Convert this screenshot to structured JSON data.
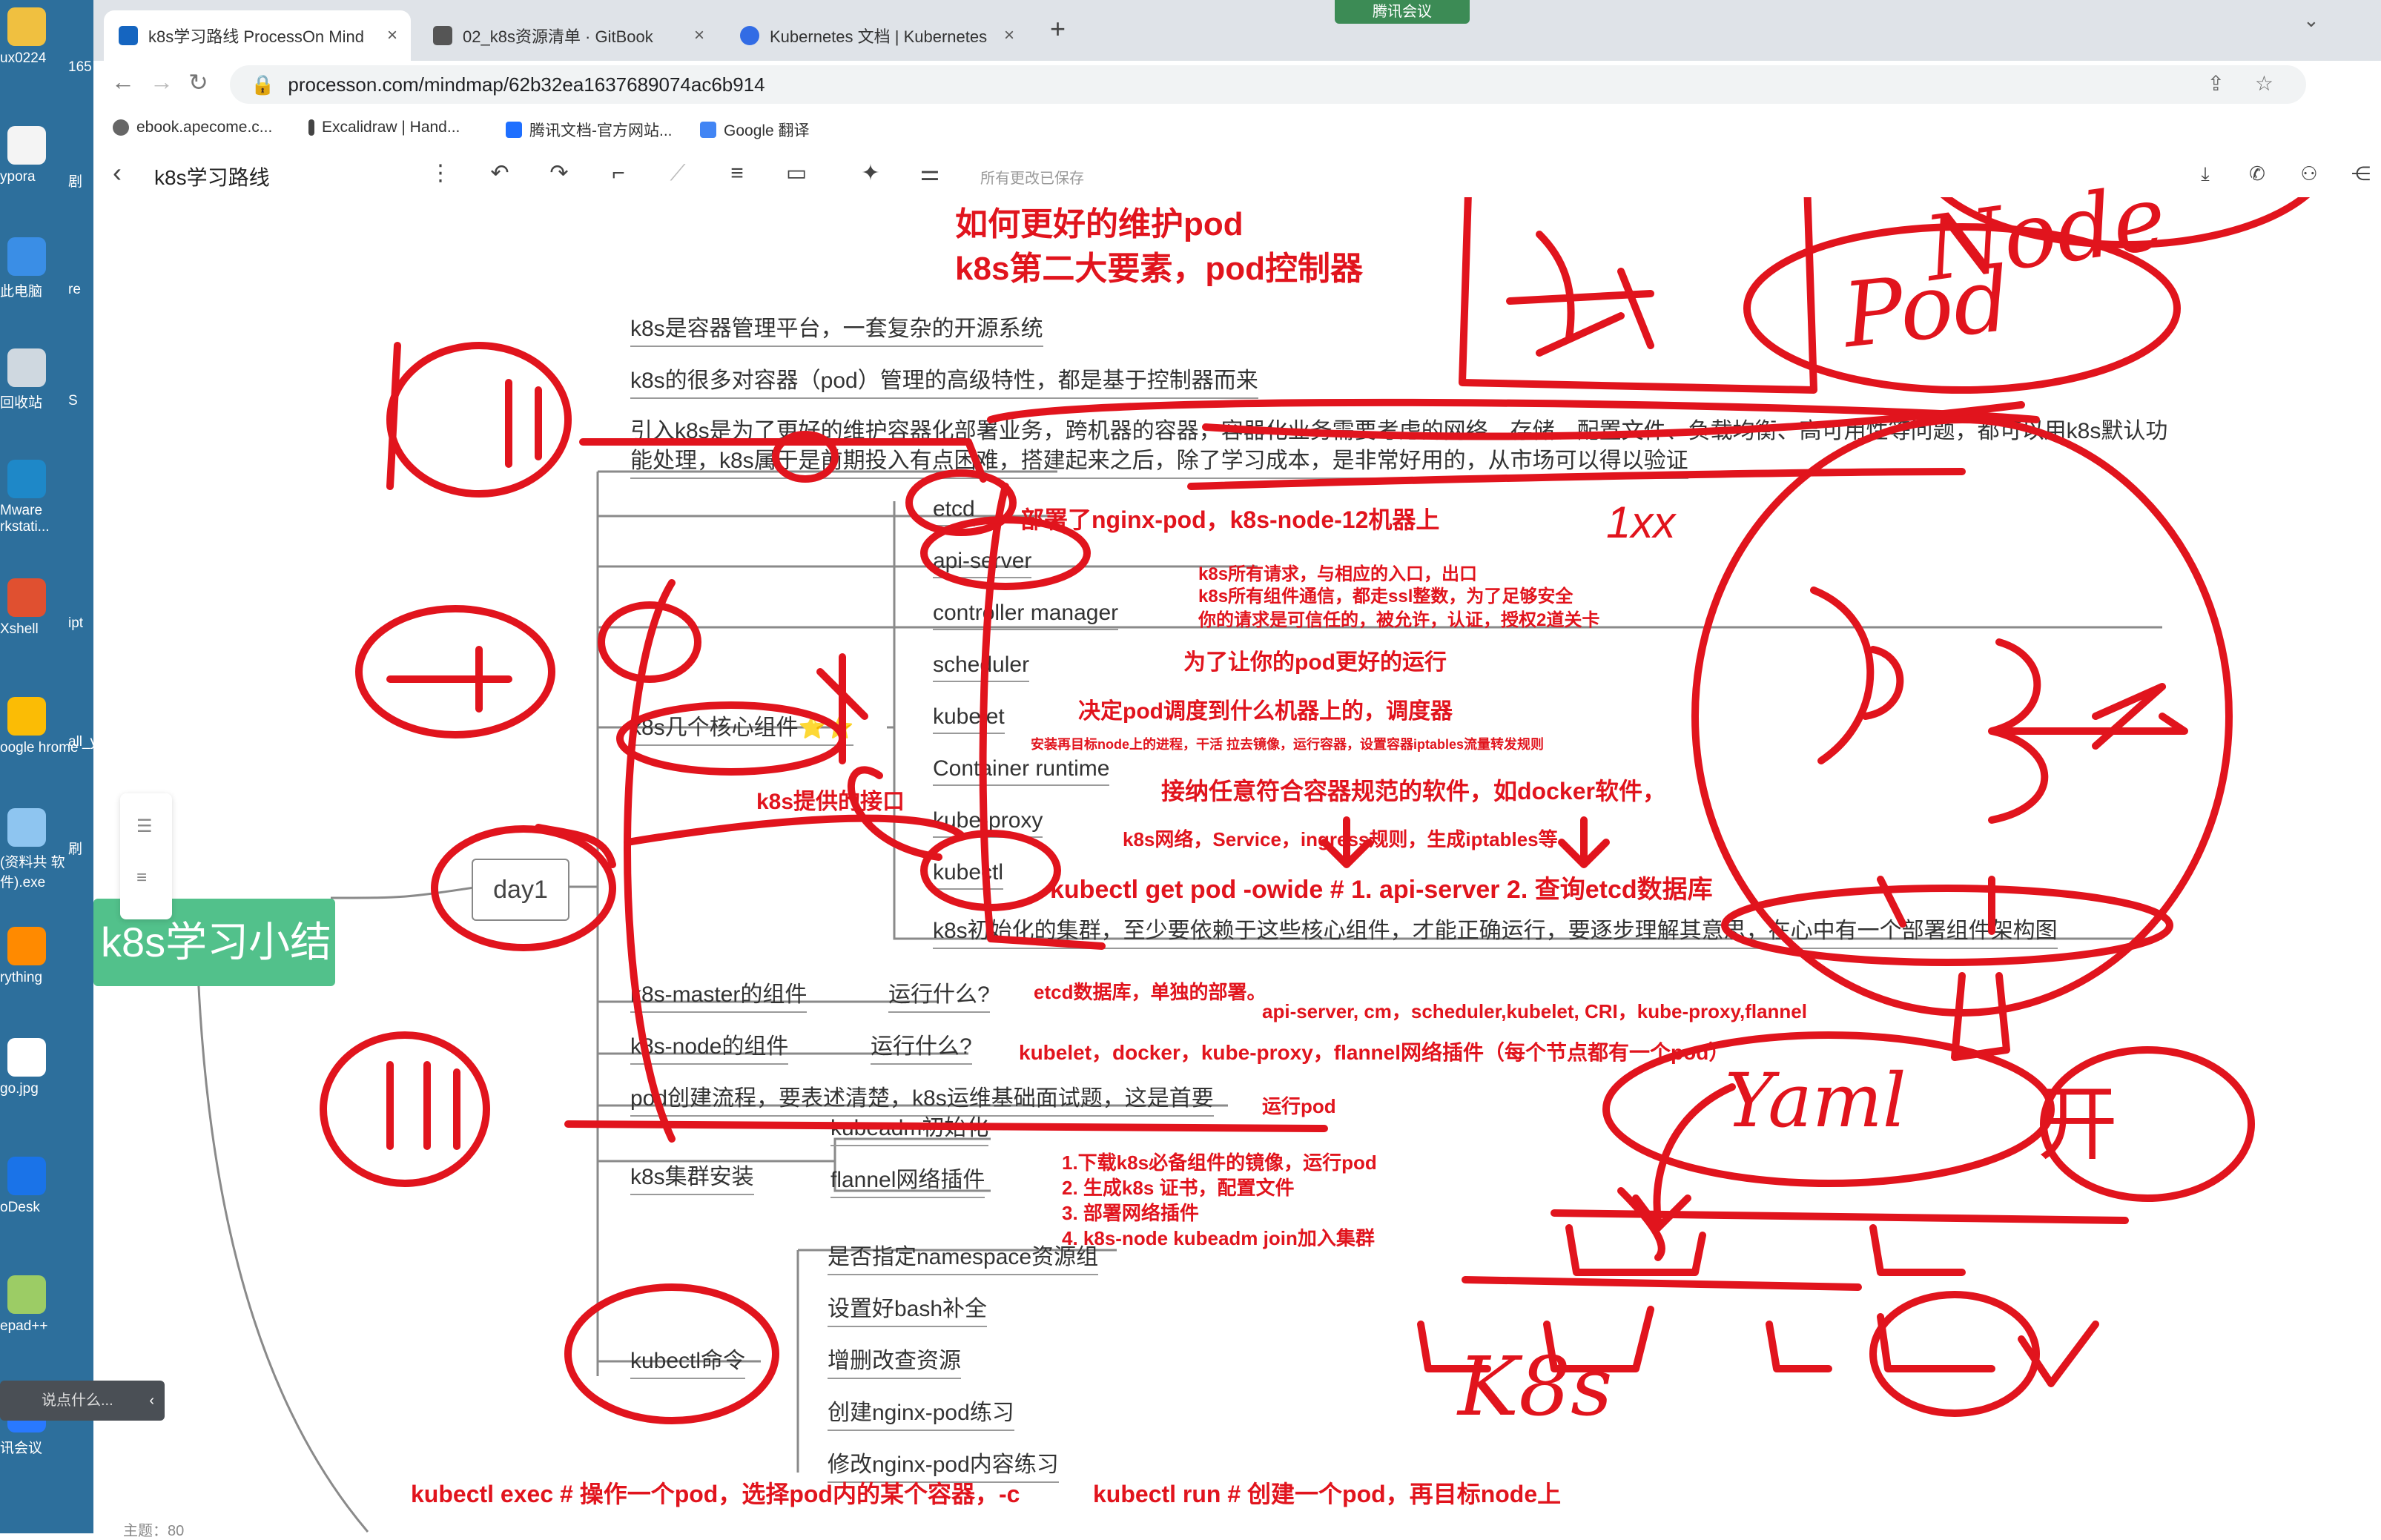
{
  "desktop": {
    "icons": [
      {
        "label": "ux0224",
        "icon": "folder-icon"
      },
      {
        "label": "ypora",
        "icon": "typora-icon"
      },
      {
        "label": "此电脑",
        "icon": "computer-icon"
      },
      {
        "label": "回收站",
        "icon": "recycle-bin-icon"
      },
      {
        "label": "Mware rkstati...",
        "icon": "vmware-icon"
      },
      {
        "label": "Xshell",
        "icon": "xshell-icon"
      },
      {
        "label": "oogle hrome",
        "icon": "chrome-icon"
      },
      {
        "label": "(资料共 软件).exe",
        "icon": "exe-icon"
      },
      {
        "label": "rything",
        "icon": "everything-icon"
      },
      {
        "label": "go.jpg",
        "icon": "image-icon"
      },
      {
        "label": "oDesk",
        "icon": "todesk-icon"
      },
      {
        "label": "epad++",
        "icon": "notepad-icon"
      },
      {
        "label": "讯会议",
        "icon": "meeting-icon"
      }
    ],
    "second_column": [
      "165",
      "剧",
      "re",
      "S",
      "ipt",
      "all_y",
      "刷"
    ],
    "chat_hint": "说点什么..."
  },
  "browser": {
    "meeting_badge": "腾讯会议",
    "tabs": [
      {
        "label": "k8s学习路线 ProcessOn Mind",
        "icon_color": "#1565c0"
      },
      {
        "label": "02_k8s资源清单 · GitBook",
        "icon_color": "#555555"
      },
      {
        "label": "Kubernetes 文档 | Kubernetes",
        "icon_color": "#326ce5"
      }
    ],
    "url": "processon.com/mindmap/62b32ea1637689074ac6b914",
    "bookmarks": [
      {
        "label": "ebook.apecome.c..."
      },
      {
        "label": "Excalidraw | Hand..."
      },
      {
        "label": "腾讯文档-官方网站..."
      },
      {
        "label": "Google 翻译"
      }
    ]
  },
  "app": {
    "title": "k8s学习路线",
    "saved_status": "所有更改已保存",
    "root": "k8s学习小结",
    "day_node": "day1",
    "branches": {
      "intro": [
        "k8s是容器管理平台，一套复杂的开源系统",
        "k8s的很多对容器（pod）管理的高级特性，都是基于控制器而来",
        "引入k8s是为了更好的维护容器化部署业务，跨机器的容器，容器化业务需要考虑的网络、存储、配置文件、负载均衡、高可用性等问题，都可以用k8s默认功",
        "能处理，k8s属于是前期投入有点困难，搭建起来之后，除了学习成本，是非常好用的，从市场可以得以验证"
      ],
      "components_label": "k8s几个核心组件⭐⭐",
      "components": [
        "etcd",
        "api-server",
        "controller manager",
        "scheduler",
        "kubelet",
        "Container runtime",
        "kube-proxy",
        "kubectl"
      ],
      "components_summary": "k8s初始化的集群，至少要依赖于这些核心组件，才能正确运行，要逐步理解其意思，在心中有一个部署组件架构图",
      "master": "k8s-master的组件",
      "master_q": "运行什么?",
      "node": "k8s-node的组件",
      "node_q": "运行什么?",
      "pod_flow": "pod创建流程，要表述清楚，k8s运维基础面试题，这是首要",
      "install": "k8s集群安装",
      "install_items": [
        "kubeadm初始化",
        "flannel网络插件"
      ],
      "kubectl_label": "kubectl命令",
      "kubectl_items": [
        "是否指定namespace资源组",
        "设置好bash补全",
        "增删改查资源",
        "创建nginx-pod练习",
        "修改nginx-pod内容练习"
      ]
    },
    "status_bar": "主题：80"
  },
  "annotations": {
    "heading1": "如何更好的维护pod",
    "heading2": "k8s第二大要素，pod控制器",
    "etcd_note": "部署了nginx-pod，k8s-node-12机器上",
    "etcd_note2": "1xx",
    "api_note1": "k8s所有请求，与相应的入口，出口",
    "api_note2": "k8s所有组件通信，都走ssl整数，为了足够安全",
    "api_note3": "你的请求是可信任的，被允许，认证，授权2道关卡",
    "controller_note": "为了让你的pod更好的运行",
    "scheduler_note": "决定pod调度到什么机器上的，调度器",
    "kubelet_note": "安装再目标node上的进程，干活 拉去镜像，运行容器，设置容器iptables流量转发规则",
    "interface_note": "k8s提供的接口",
    "runtime_note": "接纳任意符合容器规范的软件，如docker软件，",
    "kubeproxy_note": "k8s网络，Service，ingress规则，生成iptables等",
    "kubectl_note": "kubectl   get pod -owide  #  1. api-server   2. 查询etcd数据库",
    "master_note": "etcd数据库，单独的部署。",
    "master_note2": "api-server, cm，scheduler,kubelet, CRI，kube-proxy,flannel",
    "node_note": "kubelet，docker，kube-proxy，flannel网络插件（每个节点都有一个pod）",
    "podflow_note": "运行pod",
    "install_steps": [
      "1.下载k8s必备组件的镜像，运行pod",
      "2. 生成k8s 证书，配置文件",
      "3. 部署网络插件",
      "4. k8s-node kubeadm join加入集群"
    ],
    "exec_note": "kubectl exec # 操作一个pod，选择pod内的某个容器，-c",
    "run_note": "kubectl   run  # 创建一个pod，再目标node上",
    "hand_node": "Node",
    "hand_pod": "Pod",
    "hand_yaml": "Yaml",
    "hand_k8s": "K8s",
    "hand_kai": "开"
  }
}
